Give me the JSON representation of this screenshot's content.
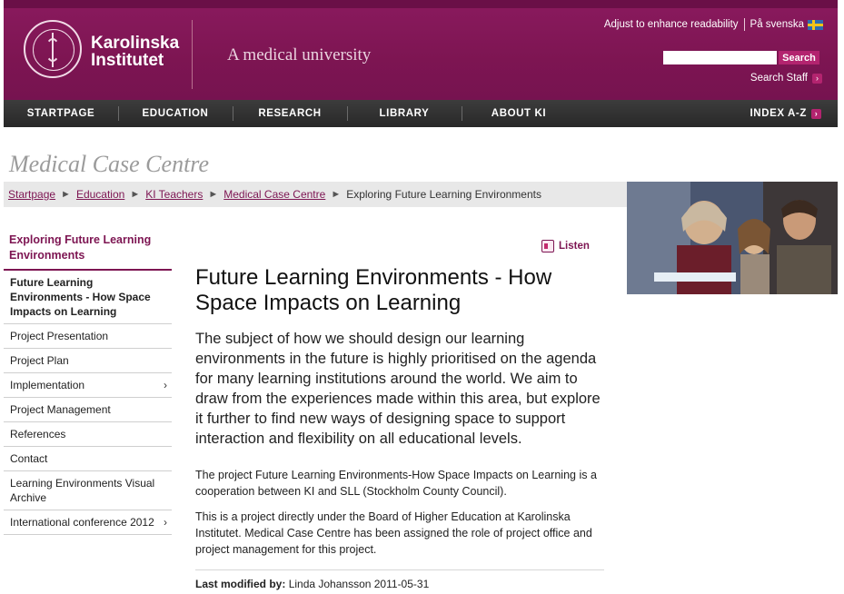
{
  "header": {
    "logo_line1": "Karolinska",
    "logo_line2": "Institutet",
    "tagline": "A medical university",
    "readability_link": "Adjust to enhance readability",
    "language_link": "På svenska",
    "search_button": "Search",
    "search_value": "",
    "search_staff": "Search Staff"
  },
  "nav": {
    "items": [
      "STARTPAGE",
      "EDUCATION",
      "RESEARCH",
      "LIBRARY",
      "ABOUT KI"
    ],
    "index": "INDEX A-Z"
  },
  "section_title": "Medical Case Centre",
  "breadcrumb": {
    "items": [
      "Startpage",
      "Education",
      "KI Teachers",
      "Medical Case Centre"
    ],
    "current": "Exploring Future Learning Environments"
  },
  "sidebar": {
    "heading": "Exploring Future Learning Environments",
    "items": [
      {
        "label": "Future Learning Environments - How Space Impacts on Learning",
        "current": true,
        "has_children": false
      },
      {
        "label": "Project Presentation",
        "current": false,
        "has_children": false
      },
      {
        "label": "Project Plan",
        "current": false,
        "has_children": false
      },
      {
        "label": "Implementation",
        "current": false,
        "has_children": true
      },
      {
        "label": "Project Management",
        "current": false,
        "has_children": false
      },
      {
        "label": "References",
        "current": false,
        "has_children": false
      },
      {
        "label": "Contact",
        "current": false,
        "has_children": false
      },
      {
        "label": "Learning Environments Visual Archive",
        "current": false,
        "has_children": false
      },
      {
        "label": "International conference 2012",
        "current": false,
        "has_children": true
      }
    ]
  },
  "listen_label": "Listen",
  "main": {
    "title": "Future Learning Environments - How Space Impacts on Learning",
    "intro": "The subject of how we should design our learning environments in the future is highly prioritised on the agenda for many learning institutions around the world. We aim to draw from the experiences made within this area, but explore it further to find new ways of designing space to support interaction and flexibility on all educational levels.",
    "para1": "The project Future Learning Environments-How Space Impacts on Learning is a cooperation between KI and SLL (Stockholm County Council).",
    "para2": "This is a project directly under the Board of Higher Education at Karolinska Institutet. Medical Case Centre has been assigned the role of project office and project management for this project.",
    "last_modified_label": "Last modified by:",
    "last_modified_value": "Linda Johansson 2011-05-31"
  },
  "colors": {
    "brand": "#7d1552",
    "accent": "#b3246f",
    "nav_bg": "#2e2e2e"
  },
  "icons": [
    "ki-seal-logo",
    "swedish-flag-icon",
    "arrow-right-icon",
    "chevron-right-icon",
    "speaker-icon"
  ]
}
